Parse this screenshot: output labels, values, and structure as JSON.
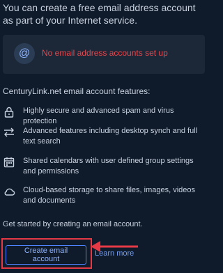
{
  "intro_text": "You can create a free email address account as part of your Internet service.",
  "empty_state": {
    "icon": "at-icon",
    "message": "No email address accounts set up"
  },
  "features_title": "CenturyLink.net email account features:",
  "features": [
    {
      "icon": "lock-icon",
      "text": "Highly secure and advanced spam and virus protection"
    },
    {
      "icon": "sync-arrows-icon",
      "text": "Advanced features including desktop synch and full text search"
    },
    {
      "icon": "calendar-icon",
      "text": "Shared calendars with user defined group settings and permissions"
    },
    {
      "icon": "cloud-icon",
      "text": "Cloud-based storage to share files, images, videos and documents"
    }
  ],
  "get_started_text": "Get started by creating an email account.",
  "actions": {
    "create_label": "Create email account",
    "learn_more_label": "Learn more"
  },
  "colors": {
    "background": "#0f1a2a",
    "card": "#1c2838",
    "error_text": "#e5484d",
    "accent": "#4f83ff",
    "highlight": "#e53946"
  }
}
